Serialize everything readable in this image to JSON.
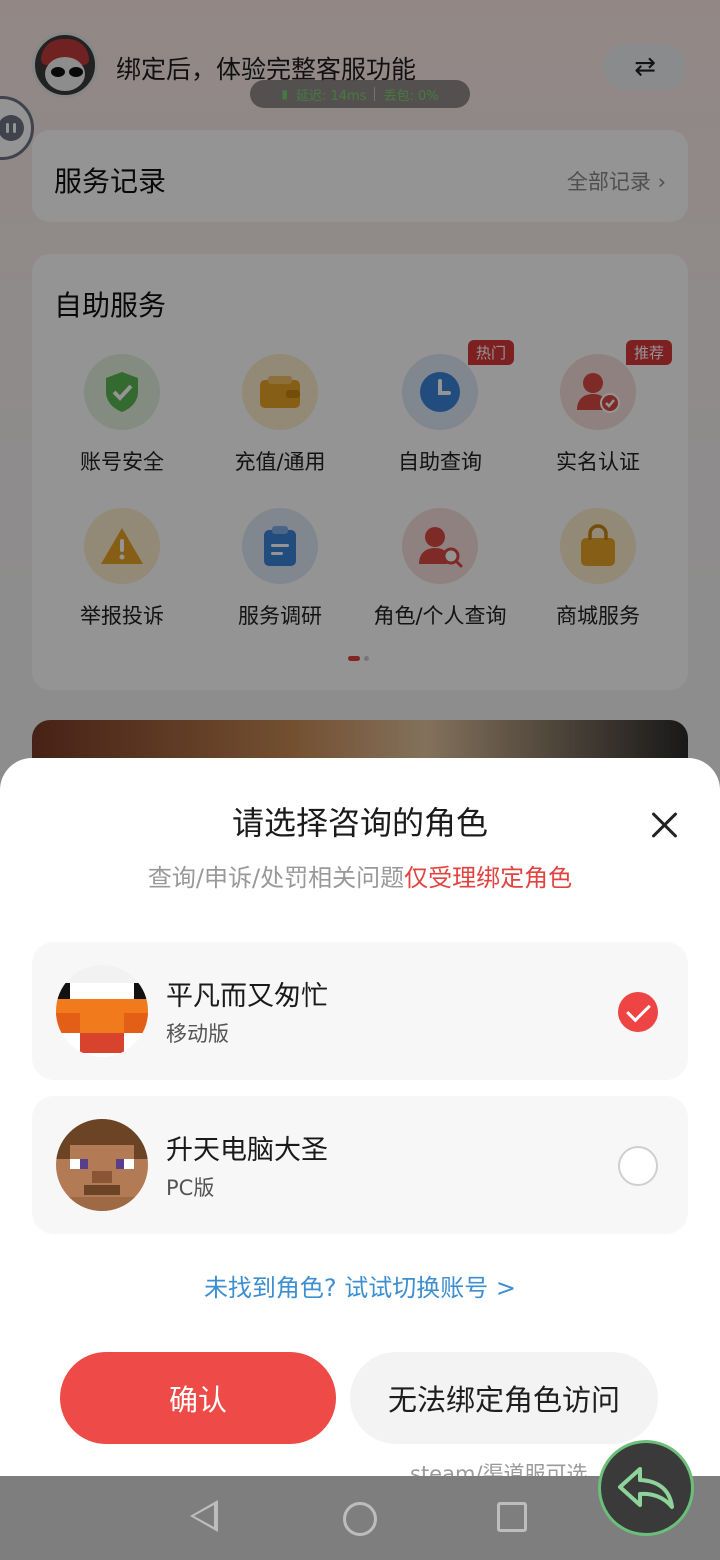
{
  "header": {
    "bind_prompt": "绑定后，体验完整客服功能",
    "latency_label": "延迟: 14ms",
    "packet_loss_label": "丢包: 0%",
    "swap_icon": "⇄"
  },
  "records": {
    "title": "服务记录",
    "all_link": "全部记录 ›"
  },
  "self_service": {
    "title": "自助服务",
    "items": [
      {
        "label": "账号安全",
        "icon": "shield-icon",
        "color": "#5ab552"
      },
      {
        "label": "充值/通用",
        "icon": "wallet-icon",
        "color": "#e8a325"
      },
      {
        "label": "自助查询",
        "icon": "clock-icon",
        "color": "#3b82d9",
        "tag": "热门"
      },
      {
        "label": "实名认证",
        "icon": "user-verify-icon",
        "color": "#d94a44",
        "tag": "推荐"
      },
      {
        "label": "举报投诉",
        "icon": "warning-icon",
        "color": "#e8a325"
      },
      {
        "label": "服务调研",
        "icon": "clipboard-icon",
        "color": "#3b82d9"
      },
      {
        "label": "角色/个人查询",
        "icon": "user-search-icon",
        "color": "#d94a44"
      },
      {
        "label": "商城服务",
        "icon": "shopping-bag-icon",
        "color": "#e8a325"
      }
    ]
  },
  "sheet": {
    "title": "请选择咨询的角色",
    "subtitle_plain": "查询/申诉/处罚相关问题",
    "subtitle_highlight": "仅受理绑定角色",
    "roles": [
      {
        "name": "平凡而又匆忙",
        "platform": "移动版",
        "selected": true
      },
      {
        "name": "升天电脑大圣",
        "platform": "PC版",
        "selected": false
      }
    ],
    "switch_link": "未找到角色? 试试切换账号 >",
    "confirm_label": "确认",
    "no_bind_label": "无法绑定角色访问",
    "no_bind_hint": "steam/渠道服可选"
  },
  "colors": {
    "accent_red": "#ee4a47",
    "link_blue": "#3d8fd0",
    "latency_green": "#78d36c"
  }
}
